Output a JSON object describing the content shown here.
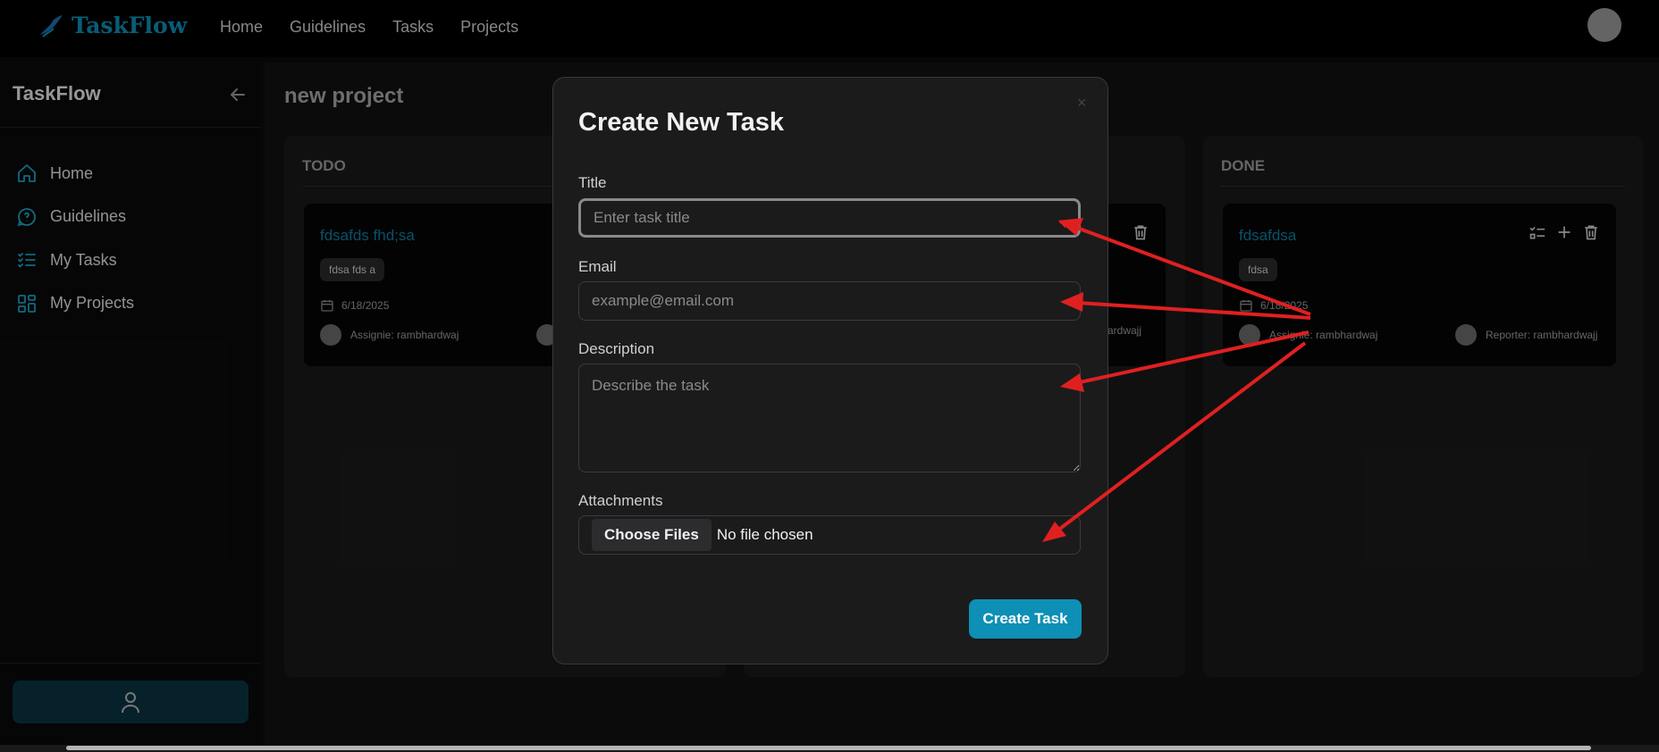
{
  "app": {
    "brand": "TaskFlow"
  },
  "topnav": {
    "links": [
      "Home",
      "Guidelines",
      "Tasks",
      "Projects"
    ]
  },
  "sidebar": {
    "title": "TaskFlow",
    "items": [
      {
        "label": "Home",
        "icon": "home-icon"
      },
      {
        "label": "Guidelines",
        "icon": "chat-help-icon"
      },
      {
        "label": "My Tasks",
        "icon": "checklist-icon"
      },
      {
        "label": "My Projects",
        "icon": "grid-icon"
      }
    ]
  },
  "project": {
    "title": "new project"
  },
  "columns": {
    "todo": {
      "header": "TODO",
      "card": {
        "title": "fdsafds fhd;sa",
        "tag": "fdsa fds a",
        "date": "6/18/2025",
        "assignee": "Assignie: rambhardwaj"
      }
    },
    "middle": {
      "card": {
        "reporter_partial": "ardwajj"
      }
    },
    "done": {
      "header": "DONE",
      "card": {
        "title": "fdsafdsa",
        "tag": "fdsa",
        "date": "6/18/2025",
        "assignee": "Assignie: rambhardwaj",
        "reporter": "Reporter: rambhardwajj"
      }
    }
  },
  "modal": {
    "title": "Create New Task",
    "close": "×",
    "title_label": "Title",
    "title_placeholder": "Enter task title",
    "email_label": "Email",
    "email_placeholder": "example@email.com",
    "description_label": "Description",
    "description_placeholder": "Describe the task",
    "attachments_label": "Attachments",
    "choose_files": "Choose Files",
    "file_status": "No file chosen",
    "submit": "Create Task"
  },
  "colors": {
    "accent": "#0e8fb5",
    "annotation_arrow": "#e02020"
  }
}
